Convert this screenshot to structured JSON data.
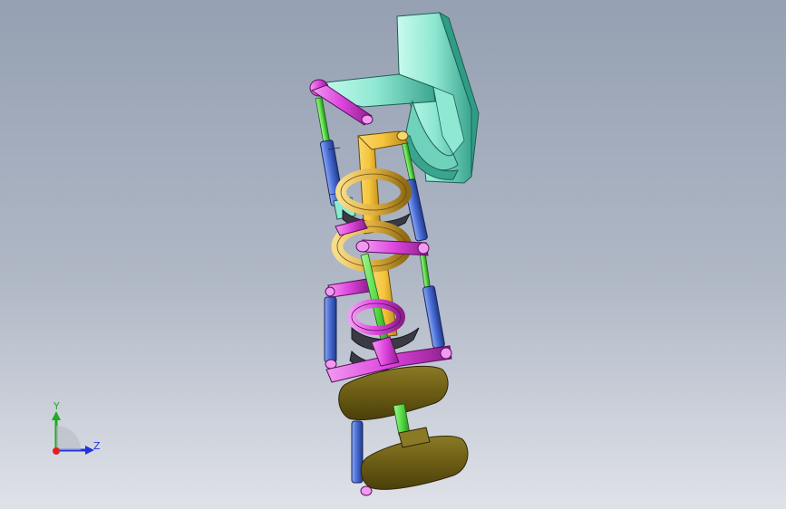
{
  "viewport": {
    "background_top": "#95a0b2",
    "background_bottom": "#dfe2e8"
  },
  "model": {
    "colors": {
      "bracket": "#8fe8d2",
      "bracket_shadow": "#2f9c86",
      "yellow_link": "#f5c43a",
      "magenta_link": "#dd44dd",
      "blue_cylinder": "#4a6fd6",
      "green_rod": "#55dd44",
      "gold_ring": "#e0b040",
      "olive_pad": "#6b5c14",
      "dark_gear": "#3a3a44"
    }
  },
  "triad": {
    "x_label": "",
    "y_label": "Y",
    "z_label": "Z",
    "x_color": "#e02020",
    "y_color": "#22aa22",
    "z_color": "#2233dd"
  }
}
